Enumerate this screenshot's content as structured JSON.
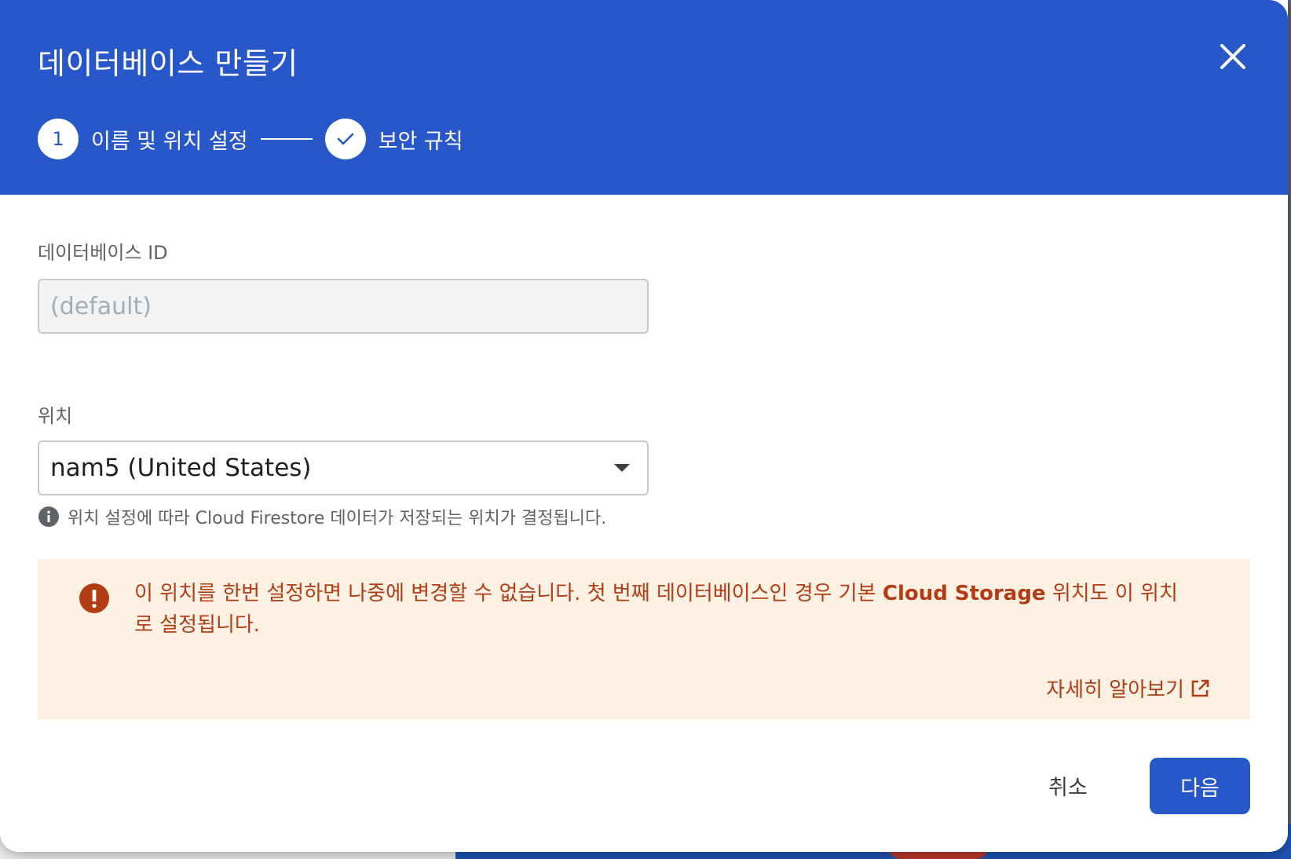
{
  "dialog": {
    "title": "데이터베이스 만들기",
    "close_icon": "close-icon"
  },
  "stepper": {
    "steps": [
      {
        "number": "1",
        "label": "이름 및 위치 설정",
        "state": "active"
      },
      {
        "label": "보안 규칙",
        "state": "completed",
        "icon": "check-icon"
      }
    ]
  },
  "form": {
    "database_id": {
      "label": "데이터베이스 ID",
      "placeholder": "(default)",
      "disabled": true
    },
    "location": {
      "label": "위치",
      "selected": "nam5 (United States)",
      "hint": "위치 설정에 따라 Cloud Firestore 데이터가 저장되는 위치가 결정됩니다.",
      "hint_icon": "info-icon"
    }
  },
  "warning": {
    "icon": "error-icon",
    "text_before": "이 위치를 한번 설정하면 나중에 변경할 수 없습니다. 첫 번째 데이터베이스인 경우 기본 ",
    "text_bold": "Cloud Storage",
    "text_after": " 위치도 이 위치로 설정됩니다.",
    "link": "자세히 알아보기",
    "link_icon": "open-in-new-icon"
  },
  "footer": {
    "cancel_label": "취소",
    "next_label": "다음"
  },
  "colors": {
    "header_blue": "#2757c9",
    "warning_bg": "#fcf1e3",
    "warning_text": "#b23d14"
  }
}
